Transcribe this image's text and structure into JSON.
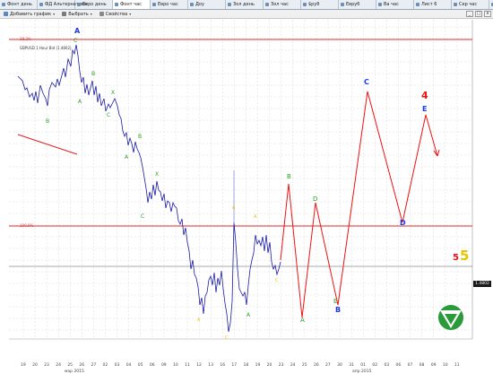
{
  "tabs": [
    "Фонт день",
    "ФД Альтернатива",
    "Евро день",
    "Фонт час",
    "Евро час",
    "Доу",
    "Зол день",
    "Зол час",
    "$руб",
    "Евруб",
    "Ва час",
    "Лист 6",
    "Сер час",
    "Сер день"
  ],
  "toolbar": {
    "add_chart": "Добавить график",
    "select": "Выбрать",
    "properties": "Свойства"
  },
  "chart": {
    "symbol_line": "GBPUSD 1 Hour Bid (1.4802)",
    "current_price": "1.4802",
    "level_upper_label": "38.2%",
    "level_lower_label": "100.0%",
    "x_ticks": [
      "19",
      "20",
      "23",
      "24",
      "25",
      "26",
      "27",
      "02",
      "03",
      "04",
      "05",
      "06",
      "09",
      "10",
      "11",
      "12",
      "13",
      "16",
      "17",
      "18",
      "19",
      "20",
      "23",
      "24",
      "25",
      "26",
      "27",
      "30",
      "31",
      "01",
      "02",
      "03",
      "06",
      "07",
      "08",
      "09",
      "10",
      "11"
    ],
    "months": [
      "мар 2015",
      "апр 2015"
    ],
    "wave_labels": {
      "A": "A",
      "B": "B",
      "C": "C",
      "D": "D",
      "E": "E",
      "X": "X",
      "four": "4",
      "five_red": "5",
      "five_yellow": "5"
    },
    "colors": {
      "up_line": "#ff0000",
      "price_line": "#1a1aa0",
      "accent_blue": "#1a3adf",
      "accent_green": "#27a227",
      "accent_yellow": "#e6c400"
    }
  },
  "window_controls": {
    "minimize": "_",
    "maximize": "□",
    "close": "x"
  }
}
